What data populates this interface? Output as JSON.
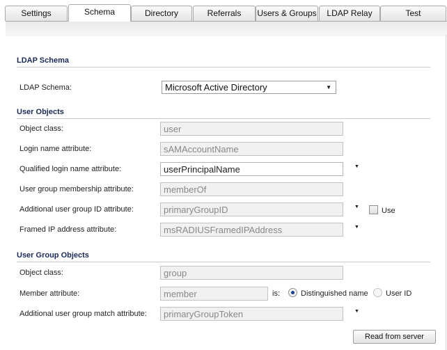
{
  "tabs": [
    {
      "label": "Settings"
    },
    {
      "label": "Schema"
    },
    {
      "label": "Directory"
    },
    {
      "label": "Referrals"
    },
    {
      "label": "Users & Groups"
    },
    {
      "label": "LDAP Relay"
    },
    {
      "label": "Test"
    }
  ],
  "active_tab": "Schema",
  "ldap_schema": {
    "heading": "LDAP Schema",
    "label": "LDAP Schema:",
    "selected": "Microsoft Active Directory"
  },
  "user_objects": {
    "heading": "User Objects",
    "object_class": {
      "label": "Object class:",
      "value": "user"
    },
    "login_name": {
      "label": "Login name attribute:",
      "value": "sAMAccountName"
    },
    "qualified_login": {
      "label": "Qualified login name attribute:",
      "value": "userPrincipalName"
    },
    "group_membership": {
      "label": "User group membership attribute:",
      "value": "memberOf"
    },
    "additional_group_id": {
      "label": "Additional user group ID attribute:",
      "value": "primaryGroupID",
      "use_label": "Use",
      "use_checked": false
    },
    "framed_ip": {
      "label": "Framed IP address attribute:",
      "value": "msRADIUSFramedIPAddress"
    }
  },
  "group_objects": {
    "heading": "User Group Objects",
    "object_class": {
      "label": "Object class:",
      "value": "group"
    },
    "member": {
      "label": "Member attribute:",
      "value": "member",
      "is_label": "is:",
      "option1": "Distinguished name",
      "option2": "User ID",
      "selected": "Distinguished name"
    },
    "additional_match": {
      "label": "Additional user group match attribute:",
      "value": "primaryGroupToken"
    }
  },
  "buttons": {
    "read_from_server": "Read from server"
  }
}
